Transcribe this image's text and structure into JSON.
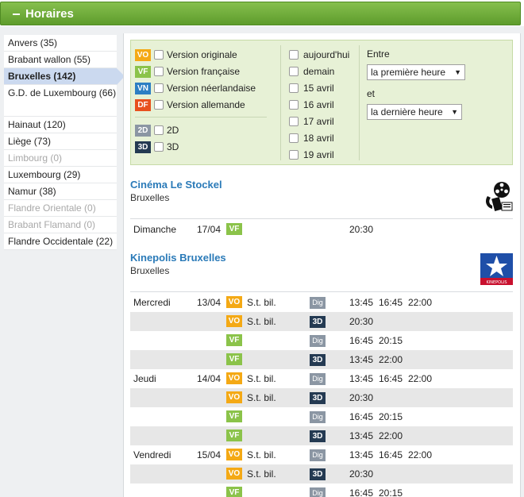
{
  "header": {
    "title": "Horaires"
  },
  "regions": [
    {
      "label": "Anvers (35)",
      "state": "normal"
    },
    {
      "label": "Brabant wallon (55)",
      "state": "normal"
    },
    {
      "label": "Bruxelles (142)",
      "state": "selected"
    },
    {
      "label": "G.D. de Luxembourg (66)",
      "state": "normal"
    },
    {
      "label": "Hainaut (120)",
      "state": "normal"
    },
    {
      "label": "Liège (73)",
      "state": "normal"
    },
    {
      "label": "Limbourg (0)",
      "state": "disabled"
    },
    {
      "label": "Luxembourg (29)",
      "state": "normal"
    },
    {
      "label": "Namur (38)",
      "state": "normal"
    },
    {
      "label": "Flandre Orientale (0)",
      "state": "disabled"
    },
    {
      "label": "Brabant Flamand (0)",
      "state": "disabled"
    },
    {
      "label": "Flandre Occidentale (22)",
      "state": "normal"
    }
  ],
  "filters": {
    "versions": [
      {
        "badge": "VO",
        "label": "Version originale"
      },
      {
        "badge": "VF",
        "label": "Version française"
      },
      {
        "badge": "VN",
        "label": "Version néerlandaise"
      },
      {
        "badge": "DF",
        "label": "Version allemande"
      }
    ],
    "formats": [
      {
        "badge": "2D",
        "label": "2D"
      },
      {
        "badge": "3D",
        "label": "3D"
      }
    ],
    "days": [
      "aujourd'hui",
      "demain",
      "15 avril",
      "16 avril",
      "17 avril",
      "18 avril",
      "19 avril"
    ],
    "entre_label": "Entre",
    "et_label": "et",
    "from_select": "la première heure",
    "to_select": "la dernière heure"
  },
  "cinemas": [
    {
      "name": "Cinéma Le Stockel",
      "city": "Bruxelles",
      "logo_text": "Cinéma Le Stockel",
      "rows": [
        {
          "day": "Dimanche",
          "date": "17/04",
          "lang": "VF",
          "sub": "",
          "fmt": "",
          "times": [
            "20:30"
          ]
        }
      ]
    },
    {
      "name": "Kinepolis Bruxelles",
      "city": "Bruxelles",
      "logo_text": "KINEPOLIS",
      "rows": [
        {
          "day": "Mercredi",
          "date": "13/04",
          "lang": "VO",
          "sub": "S.t. bil.",
          "fmt": "Dig",
          "times": [
            "13:45",
            "16:45",
            "22:00"
          ]
        },
        {
          "day": "",
          "date": "",
          "lang": "VO",
          "sub": "S.t. bil.",
          "fmt": "3D",
          "times": [
            "20:30"
          ]
        },
        {
          "day": "",
          "date": "",
          "lang": "VF",
          "sub": "",
          "fmt": "Dig",
          "times": [
            "16:45",
            "20:15"
          ]
        },
        {
          "day": "",
          "date": "",
          "lang": "VF",
          "sub": "",
          "fmt": "3D",
          "times": [
            "13:45",
            "22:00"
          ]
        },
        {
          "day": "Jeudi",
          "date": "14/04",
          "lang": "VO",
          "sub": "S.t. bil.",
          "fmt": "Dig",
          "times": [
            "13:45",
            "16:45",
            "22:00"
          ]
        },
        {
          "day": "",
          "date": "",
          "lang": "VO",
          "sub": "S.t. bil.",
          "fmt": "3D",
          "times": [
            "20:30"
          ]
        },
        {
          "day": "",
          "date": "",
          "lang": "VF",
          "sub": "",
          "fmt": "Dig",
          "times": [
            "16:45",
            "20:15"
          ]
        },
        {
          "day": "",
          "date": "",
          "lang": "VF",
          "sub": "",
          "fmt": "3D",
          "times": [
            "13:45",
            "22:00"
          ]
        },
        {
          "day": "Vendredi",
          "date": "15/04",
          "lang": "VO",
          "sub": "S.t. bil.",
          "fmt": "Dig",
          "times": [
            "13:45",
            "16:45",
            "22:00"
          ]
        },
        {
          "day": "",
          "date": "",
          "lang": "VO",
          "sub": "S.t. bil.",
          "fmt": "3D",
          "times": [
            "20:30"
          ]
        },
        {
          "day": "",
          "date": "",
          "lang": "VF",
          "sub": "",
          "fmt": "Dig",
          "times": [
            "16:45",
            "20:15"
          ]
        }
      ]
    }
  ]
}
